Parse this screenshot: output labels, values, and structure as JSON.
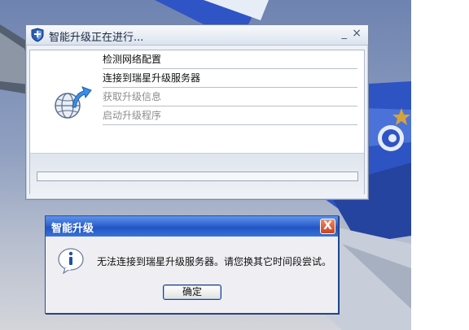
{
  "upgrade_window": {
    "title": "智能升级正在进行...",
    "minimize_glyph": "_",
    "close_glyph": "×",
    "steps": [
      {
        "label": "检测网络配置",
        "state": "done"
      },
      {
        "label": "连接到瑞星升级服务器",
        "state": "done"
      },
      {
        "label": "获取升级信息",
        "state": "pending"
      },
      {
        "label": "启动升级程序",
        "state": "pending"
      }
    ],
    "progress": 0
  },
  "dialog": {
    "title": "智能升级",
    "close_glyph": "X",
    "message": "无法连接到瑞星升级服务器。请您换其它时间段尝试。",
    "ok_label": "确定"
  },
  "icons": {
    "window": "shield-icon",
    "update": "globe-update-icon",
    "dialog": "info-icon"
  },
  "colors": {
    "dialog_title": "#2a5cc9",
    "accent_arrow": "#3a8ee6",
    "close_button": "#d8552c"
  }
}
